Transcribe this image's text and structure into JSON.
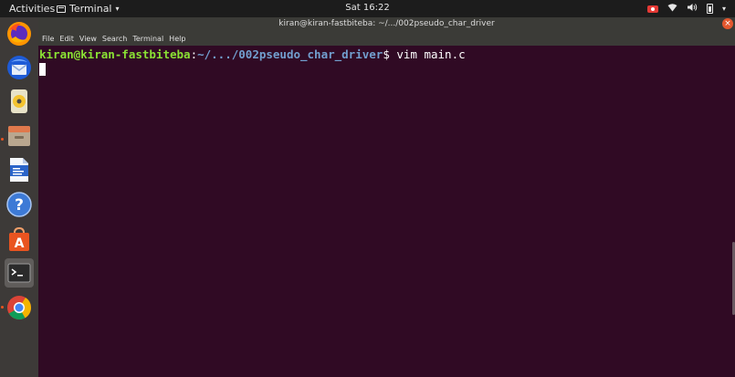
{
  "topbar": {
    "activities": "Activities",
    "app_name": "Terminal",
    "clock": "Sat 16:22"
  },
  "window": {
    "title": "kiran@kiran-fastbiteba: ~/.../002pseudo_char_driver",
    "menu": [
      "File",
      "Edit",
      "View",
      "Search",
      "Terminal",
      "Help"
    ]
  },
  "terminal": {
    "user_host": "kiran@kiran-fastbiteba",
    "separator": ":",
    "path": "~/.../002pseudo_char_driver",
    "prompt_symbol": "$ ",
    "command": "vim main.c"
  },
  "dock": {
    "apps": [
      {
        "name": "firefox-icon",
        "active": false,
        "running": false
      },
      {
        "name": "thunderbird-icon",
        "active": false,
        "running": false
      },
      {
        "name": "rhythmbox-icon",
        "active": false,
        "running": false
      },
      {
        "name": "files-icon",
        "active": false,
        "running": true
      },
      {
        "name": "libreoffice-writer-icon",
        "active": false,
        "running": false
      },
      {
        "name": "help-icon",
        "active": false,
        "running": false
      },
      {
        "name": "software-center-icon",
        "active": false,
        "running": false
      },
      {
        "name": "terminal-icon",
        "active": true,
        "running": false
      },
      {
        "name": "chrome-icon",
        "active": false,
        "running": true
      }
    ]
  },
  "colors": {
    "terminal_bg": "#300a24",
    "prompt_user": "#8ae234",
    "prompt_path": "#729fcf",
    "accent": "#e95420"
  }
}
